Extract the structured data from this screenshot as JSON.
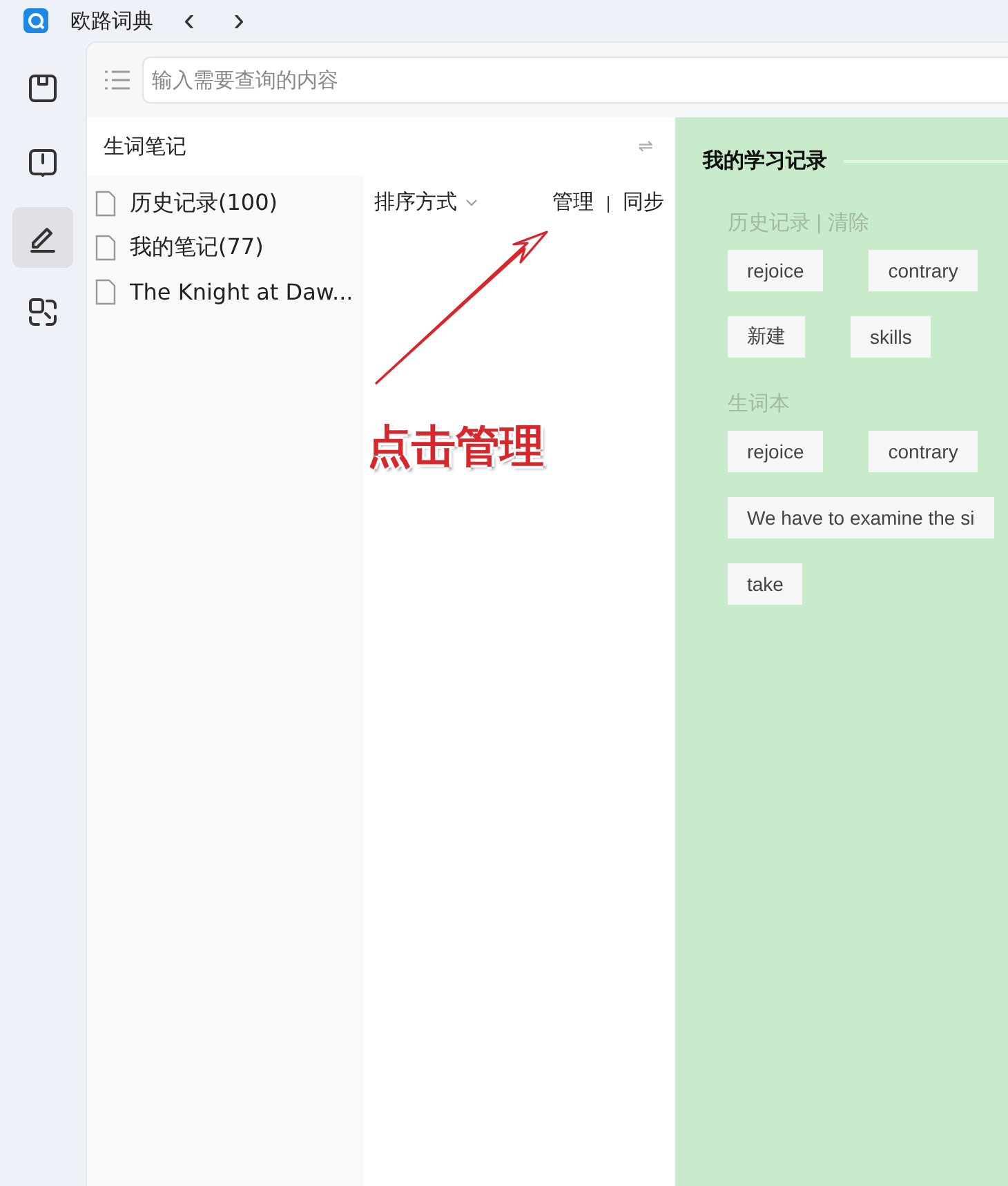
{
  "window": {
    "title": "欧路词典",
    "back": "‹",
    "forward": "›"
  },
  "rail": [
    {
      "kind": "notebook",
      "selected": false
    },
    {
      "kind": "book",
      "selected": false
    },
    {
      "kind": "pen",
      "selected": true
    },
    {
      "kind": "scan",
      "selected": false
    }
  ],
  "search": {
    "placeholder": "输入需要查询的内容"
  },
  "notes_panel": {
    "title": "生词笔记",
    "swap": "⇌",
    "items": [
      {
        "label": "历史记录(100)"
      },
      {
        "label": "我的笔记(77)"
      },
      {
        "label": "The Knight at Daw..."
      }
    ],
    "sort": "排序方式",
    "manage": "管理",
    "sync": "同步"
  },
  "study": {
    "title": "我的学习记录",
    "sections": [
      {
        "title": "历史记录",
        "divider": "|",
        "action": "清除",
        "rows": [
          [
            "rejoice",
            "contrary"
          ],
          [
            "新建",
            "skills"
          ]
        ]
      },
      {
        "title": "生词本",
        "rows": [
          [
            "rejoice",
            "contrary"
          ],
          [
            "We have to examine the si"
          ],
          [
            "take"
          ]
        ]
      }
    ]
  },
  "annotation": {
    "text": "点击管理"
  }
}
